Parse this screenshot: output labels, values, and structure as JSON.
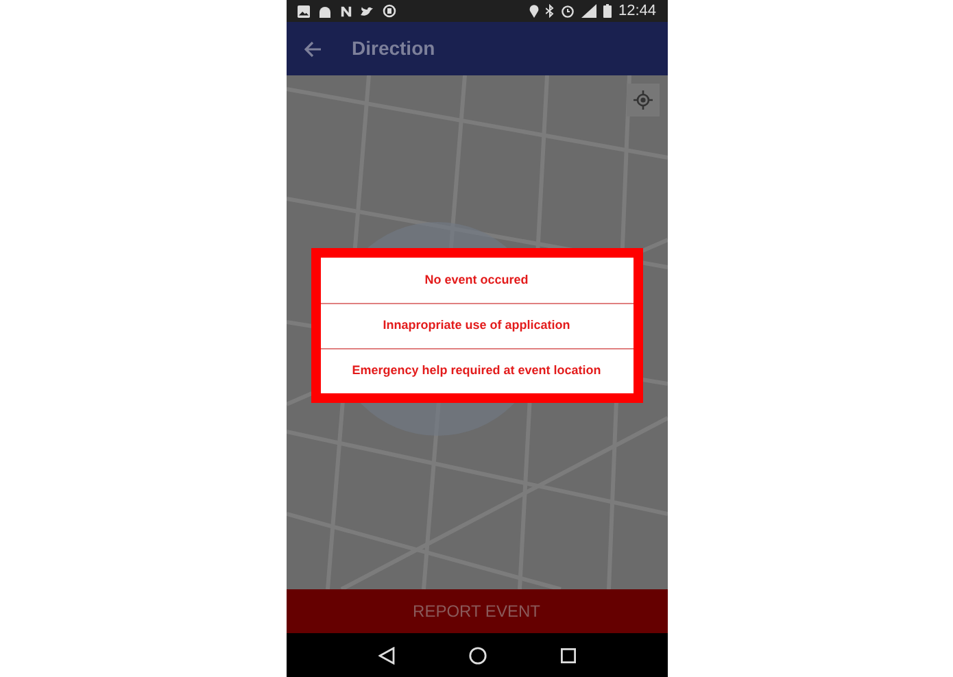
{
  "status_bar": {
    "time": "12:44"
  },
  "app_bar": {
    "title": "Direction"
  },
  "dialog": {
    "options": [
      {
        "label": "No event occured"
      },
      {
        "label": "Innapropriate use of application"
      },
      {
        "label": "Emergency help required at event location"
      }
    ]
  },
  "bottom_button": {
    "label": "REPORT EVENT"
  }
}
